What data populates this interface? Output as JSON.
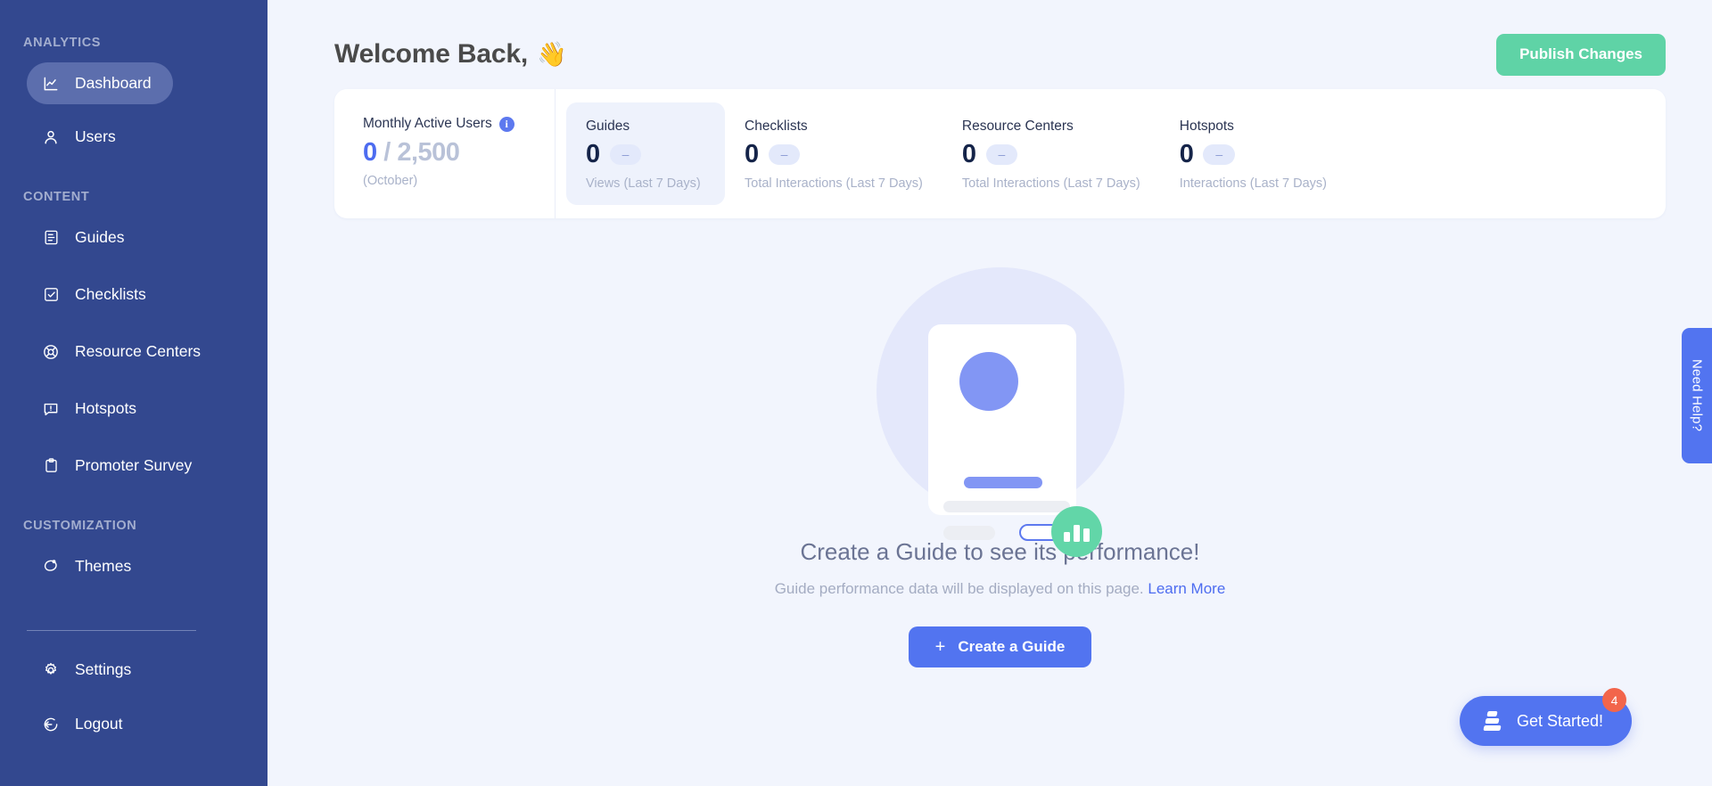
{
  "sidebar": {
    "sections": [
      {
        "title": "ANALYTICS",
        "items": [
          {
            "label": "Dashboard",
            "icon": "chart-line-icon",
            "active": true
          },
          {
            "label": "Users",
            "icon": "user-icon",
            "active": false
          }
        ]
      },
      {
        "title": "CONTENT",
        "items": [
          {
            "label": "Guides",
            "icon": "document-icon",
            "active": false
          },
          {
            "label": "Checklists",
            "icon": "checkbox-icon",
            "active": false
          },
          {
            "label": "Resource Centers",
            "icon": "lifebuoy-icon",
            "active": false
          },
          {
            "label": "Hotspots",
            "icon": "message-alert-icon",
            "active": false
          },
          {
            "label": "Promoter Survey",
            "icon": "clipboard-icon",
            "active": false
          }
        ]
      },
      {
        "title": "CUSTOMIZATION",
        "items": [
          {
            "label": "Themes",
            "icon": "palette-icon",
            "active": false
          }
        ]
      }
    ],
    "bottom": [
      {
        "label": "Settings",
        "icon": "gear-icon"
      },
      {
        "label": "Logout",
        "icon": "logout-icon"
      }
    ]
  },
  "header": {
    "title": "Welcome Back,",
    "wave_emoji": "👋",
    "publish_label": "Publish Changes"
  },
  "stats": {
    "mau": {
      "label": "Monthly Active Users",
      "info_glyph": "i",
      "current": "0",
      "separator": " / ",
      "limit": "2,500",
      "period": "(October)"
    },
    "metrics": [
      {
        "title": "Guides",
        "value": "0",
        "delta": "–",
        "sub": "Views (Last 7 Days)",
        "selected": true
      },
      {
        "title": "Checklists",
        "value": "0",
        "delta": "–",
        "sub": "Total Interactions (Last 7 Days)",
        "selected": false
      },
      {
        "title": "Resource Centers",
        "value": "0",
        "delta": "–",
        "sub": "Total Interactions (Last 7 Days)",
        "selected": false
      },
      {
        "title": "Hotspots",
        "value": "0",
        "delta": "–",
        "sub": "Interactions (Last 7 Days)",
        "selected": false
      }
    ]
  },
  "empty_state": {
    "title": "Create a Guide to see its performance!",
    "subtitle": "Guide performance data will be displayed on this page. ",
    "learn_more": "Learn More",
    "create_button": "Create a Guide",
    "plus_glyph": "+"
  },
  "widgets": {
    "need_help": "Need Help?",
    "get_started": "Get Started!",
    "get_started_badge": "4"
  },
  "colors": {
    "sidebar": "#33488f",
    "accent_blue": "#5274f0",
    "accent_green": "#5fd3a6",
    "badge_red": "#f2654b",
    "page_bg": "#f2f5fd"
  }
}
